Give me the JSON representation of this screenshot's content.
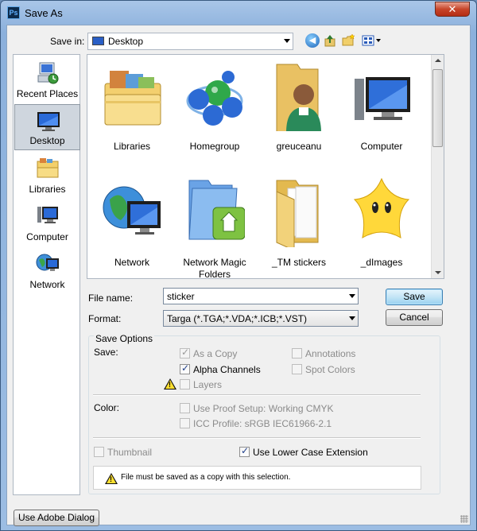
{
  "window": {
    "title": "Save As",
    "app_icon": "Ps",
    "close_glyph": "✕"
  },
  "toolbar": {
    "save_in_label": "Save in:",
    "save_in_value": "Desktop",
    "icons": [
      "back-icon",
      "up-folder-icon",
      "new-folder-icon",
      "views-menu-icon"
    ]
  },
  "places": [
    {
      "label": "Recent Places",
      "icon": "recent-places-icon",
      "active": false
    },
    {
      "label": "Desktop",
      "icon": "desktop-icon",
      "active": true
    },
    {
      "label": "Libraries",
      "icon": "libraries-icon",
      "active": false
    },
    {
      "label": "Computer",
      "icon": "computer-icon",
      "active": false
    },
    {
      "label": "Network",
      "icon": "network-icon",
      "active": false
    }
  ],
  "files": [
    {
      "label": "Libraries",
      "icon": "libraries-folder-icon"
    },
    {
      "label": "Homegroup",
      "icon": "homegroup-icon"
    },
    {
      "label": "greuceanu",
      "icon": "user-folder-icon"
    },
    {
      "label": "Computer",
      "icon": "computer-icon"
    },
    {
      "label": "Network",
      "icon": "network-globe-icon"
    },
    {
      "label": "Network Magic Folders",
      "icon": "network-magic-folder-icon"
    },
    {
      "label": "_TM stickers",
      "icon": "folder-icon"
    },
    {
      "label": "_dImages",
      "icon": "star-character-icon"
    }
  ],
  "form": {
    "file_name_label": "File name:",
    "file_name_value": "sticker",
    "format_label": "Format:",
    "format_value": "Targa (*.TGA;*.VDA;*.ICB;*.VST)",
    "save_button": "Save",
    "cancel_button": "Cancel"
  },
  "save_options": {
    "title": "Save Options",
    "save_label": "Save:",
    "as_a_copy": "As a Copy",
    "alpha_channels": "Alpha Channels",
    "layers": "Layers",
    "annotations": "Annotations",
    "spot_colors": "Spot Colors",
    "color_label": "Color:",
    "use_proof_setup": "Use Proof Setup:  Working CMYK",
    "icc_profile": "ICC Profile:  sRGB IEC61966-2.1",
    "thumbnail": "Thumbnail",
    "lower_case_ext": "Use Lower Case Extension",
    "warning_message": "File must be saved as a copy with this selection."
  },
  "footer": {
    "adobe_dialog_button": "Use Adobe Dialog"
  }
}
